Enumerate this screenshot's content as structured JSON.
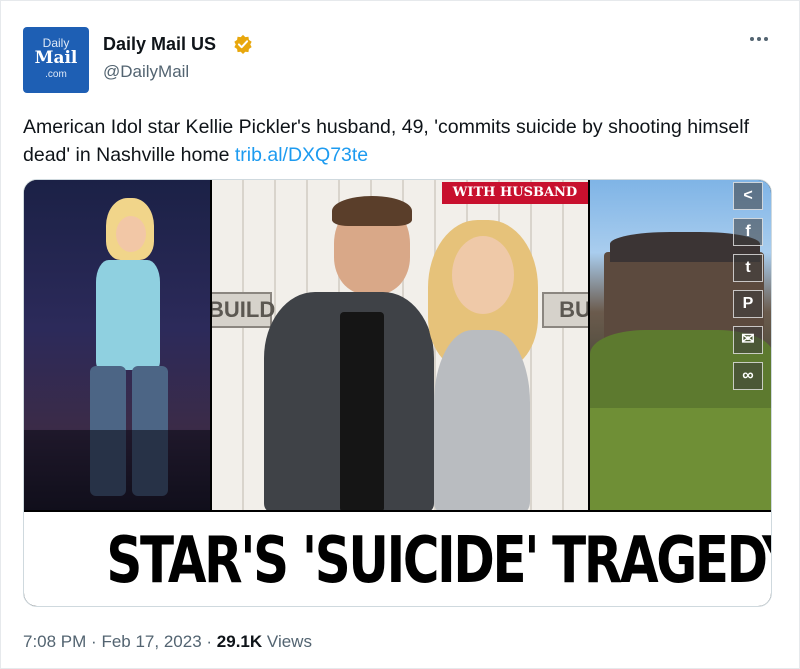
{
  "author": {
    "avatar_text": [
      "Daily",
      "Mail",
      ".com"
    ],
    "display_name": "Daily Mail US",
    "handle": "@DailyMail",
    "verified_icon": "verified-badge-icon",
    "verified_color": "#f4b400"
  },
  "tweet": {
    "text": "American Idol star Kellie Pickler's husband, 49, 'commits suicide by shooting himself dead' in Nashville home ",
    "link_text": "trib.al/DXQ73te",
    "link_color": "#1d9bf0"
  },
  "media": {
    "tag": "WITH HUSBAND",
    "sign_left": "BUILD",
    "sign_right": "BU",
    "headline": "STAR'S 'SUICIDE' TRAGEDY",
    "share_buttons": [
      {
        "icon": "share-icon",
        "glyph": "<"
      },
      {
        "icon": "facebook-icon",
        "glyph": "f"
      },
      {
        "icon": "twitter-icon",
        "glyph": "t"
      },
      {
        "icon": "pinterest-icon",
        "glyph": "P"
      },
      {
        "icon": "email-icon",
        "glyph": "✉"
      },
      {
        "icon": "link-icon",
        "glyph": "∞"
      }
    ]
  },
  "footer": {
    "time": "7:08 PM",
    "separator": "·",
    "date": "Feb 17, 2023",
    "views_count": "29.1K",
    "views_label": "Views"
  }
}
